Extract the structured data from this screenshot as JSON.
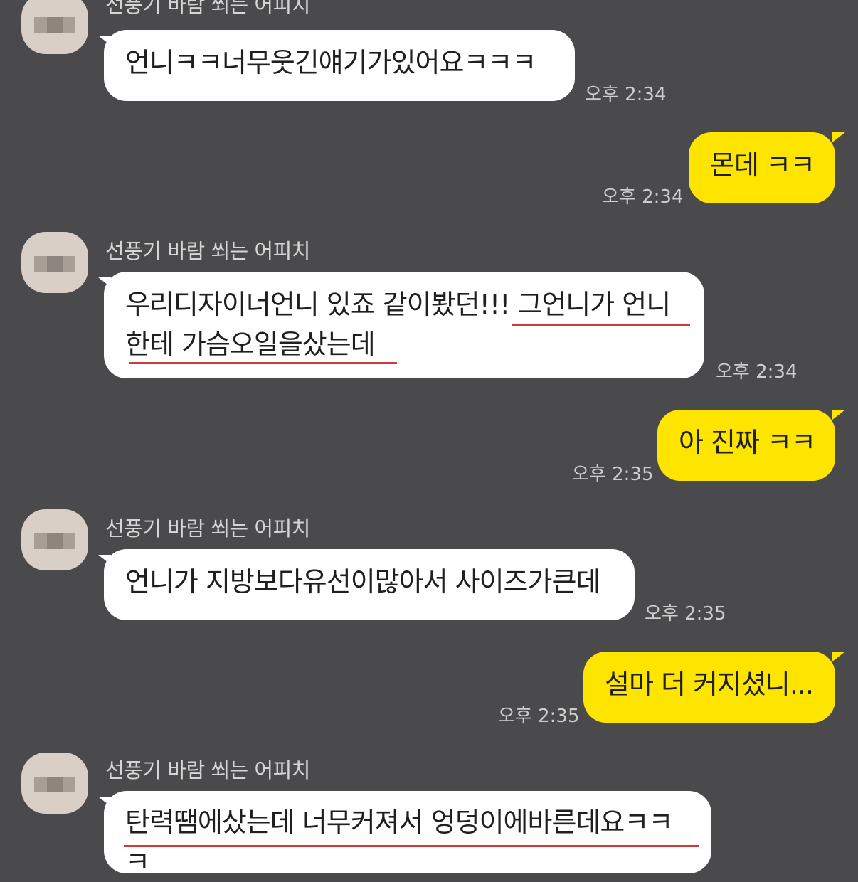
{
  "chat": {
    "sender_name": "선풍기 바람 쐬는 어피치",
    "messages": [
      {
        "text": "언니ㅋㅋ너무웃긴얘기가있어요ㅋㅋㅋ",
        "time": "오후 2:34"
      },
      {
        "text": "몬데 ㅋㅋ",
        "time": "오후 2:34"
      },
      {
        "line1": "우리디자이너언니 있죠 같이봤던!!! 그언니가 언니",
        "line2": "한테 가슴오일을샀는데",
        "time": "오후 2:34"
      },
      {
        "text": "아 진짜 ㅋㅋ",
        "time": "오후 2:35"
      },
      {
        "text": "언니가 지방보다유선이많아서 사이즈가큰데",
        "time": "오후 2:35"
      },
      {
        "text": "설마 더 커지셨니...",
        "time": "오후 2:35"
      },
      {
        "line1": "탄력땜에샀는데 너무커져서 엉덩이에바른데요ㅋㅋ",
        "line2": "ㅋ"
      }
    ]
  },
  "colors": {
    "background": "#4a494c",
    "incoming_bubble": "#ffffff",
    "outgoing_bubble": "#fee500",
    "underline": "#d0393a"
  },
  "icons": {
    "avatar": "blurred-profile-avatar-icon"
  }
}
